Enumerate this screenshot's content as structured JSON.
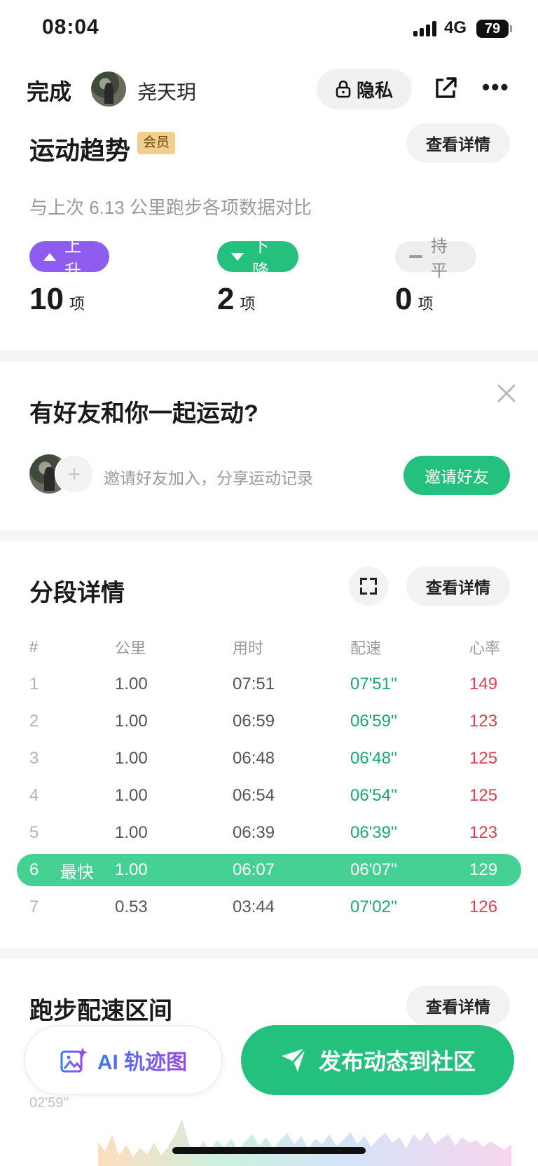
{
  "status_bar": {
    "time": "08:04",
    "network": "4G",
    "battery": "79"
  },
  "topbar": {
    "done_label": "完成",
    "username": "尧天玥",
    "privacy_label": "隐私"
  },
  "trend": {
    "title": "运动趋势",
    "vip_badge": "会员",
    "detail_label": "查看详情",
    "description": "与上次 6.13 公里跑步各项数据对比",
    "stats": [
      {
        "label": "上升",
        "count": "10",
        "unit": "项",
        "color": "#8f5cf0"
      },
      {
        "label": "下降",
        "count": "2",
        "unit": "项",
        "color": "#23c07e"
      },
      {
        "label": "持平",
        "count": "0",
        "unit": "项",
        "color": "#eeeeee"
      }
    ]
  },
  "friends": {
    "title": "有好友和你一起运动?",
    "hint": "邀请好友加入，分享运动记录",
    "invite_label": "邀请好友",
    "add_symbol": "+"
  },
  "splits": {
    "title": "分段详情",
    "detail_label": "查看详情",
    "columns": [
      "#",
      "公里",
      "用时",
      "配速",
      "心率"
    ],
    "rows": [
      {
        "idx": "1",
        "tag": "",
        "km": "1.00",
        "time": "07:51",
        "pace": "07'51''",
        "hr": "149"
      },
      {
        "idx": "2",
        "tag": "",
        "km": "1.00",
        "time": "06:59",
        "pace": "06'59''",
        "hr": "123"
      },
      {
        "idx": "3",
        "tag": "",
        "km": "1.00",
        "time": "06:48",
        "pace": "06'48''",
        "hr": "125"
      },
      {
        "idx": "4",
        "tag": "",
        "km": "1.00",
        "time": "06:54",
        "pace": "06'54''",
        "hr": "125"
      },
      {
        "idx": "5",
        "tag": "",
        "km": "1.00",
        "time": "06:39",
        "pace": "06'39''",
        "hr": "123"
      },
      {
        "idx": "6",
        "tag": "最快",
        "km": "1.00",
        "time": "06:07",
        "pace": "06'07''",
        "hr": "129"
      },
      {
        "idx": "7",
        "tag": "",
        "km": "0.53",
        "time": "03:44",
        "pace": "07'02''",
        "hr": "126"
      }
    ],
    "pace_color": "#1ea96d",
    "hr_color": "#e0404e",
    "highlight_color": "#45d193"
  },
  "pace_zone": {
    "title": "跑步配速区间",
    "detail_label": "查看详情",
    "axis_label": "02'59''"
  },
  "actions": {
    "ai_label": "AI 轨迹图",
    "publish_label": "发布动态到社区"
  },
  "colors": {
    "accent_green": "#23c07e",
    "accent_purple": "#8f5cf0"
  }
}
